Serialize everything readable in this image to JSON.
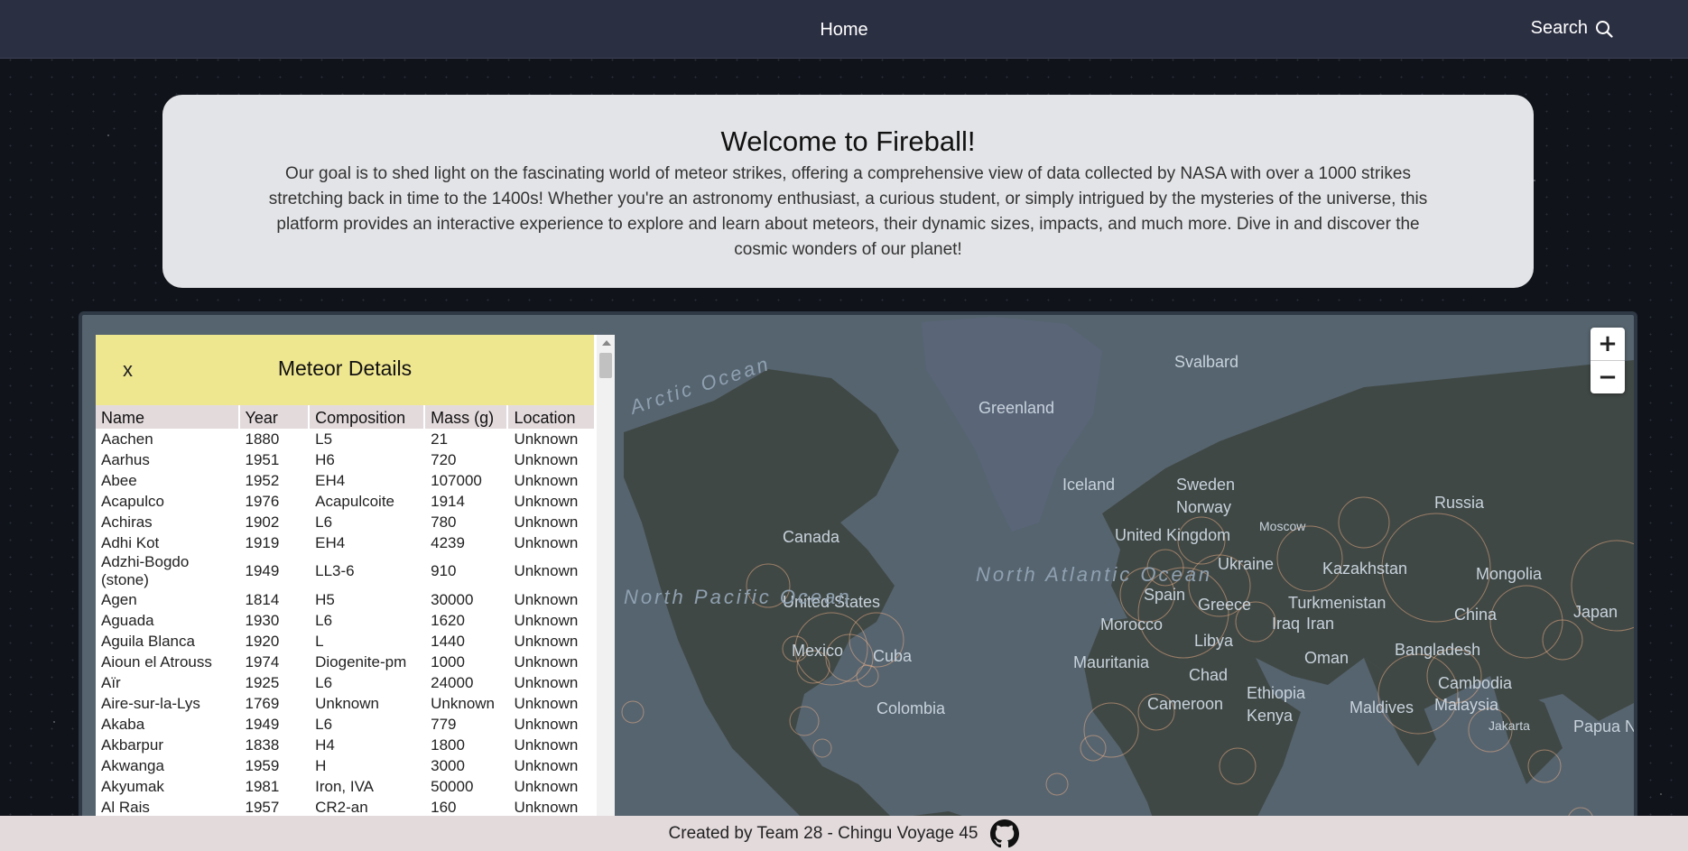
{
  "nav": {
    "home": "Home",
    "search": "Search"
  },
  "welcome": {
    "title": "Welcome to Fireball!",
    "body": "Our goal is to shed light on the fascinating world of meteor strikes, offering a comprehensive view of data collected by NASA with over a 1000 strikes stretching back in time to the 1400s! Whether you're an astronomy enthusiast, a curious student, or simply intrigued by the mysteries of the universe, this platform provides an interactive experience to explore and learn about meteors, their dynamic sizes, impacts, and much more. Dive in and discover the cosmic wonders of our planet!"
  },
  "map": {
    "zoom_in": "+",
    "zoom_out": "−",
    "labels": [
      "Svalbard",
      "Greenland",
      "Iceland",
      "Sweden",
      "Norway",
      "Russia",
      "Canada",
      "United Kingdom",
      "Moscow",
      "Ukraine",
      "Kazakhstan",
      "Mongolia",
      "Spain",
      "Greece",
      "Turkmenistan",
      "China",
      "Japan",
      "United States",
      "Iraq",
      "Iran",
      "Morocco",
      "Libya",
      "Mexico",
      "Cuba",
      "Mauritania",
      "Chad",
      "Oman",
      "Bangladesh",
      "Cambodia",
      "Malaysia",
      "Maldives",
      "Ethiopia",
      "Kenya",
      "Cameroon",
      "Colombia",
      "Jakarta",
      "Papua N"
    ],
    "oceans": [
      "Arctic Ocean",
      "North Atlantic Ocean",
      "North Pacific Ocean"
    ],
    "colors": {
      "land": "#404845",
      "water": "#56646f",
      "ice": "#5a6578",
      "dots": "#f3b48a"
    }
  },
  "panel": {
    "close": "x",
    "title": "Meteor Details",
    "columns": [
      "Name",
      "Year",
      "Composition",
      "Mass (g)",
      "Location"
    ],
    "rows": [
      [
        "Aachen",
        "1880",
        "L5",
        "21",
        "Unknown"
      ],
      [
        "Aarhus",
        "1951",
        "H6",
        "720",
        "Unknown"
      ],
      [
        "Abee",
        "1952",
        "EH4",
        "107000",
        "Unknown"
      ],
      [
        "Acapulco",
        "1976",
        "Acapulcoite",
        "1914",
        "Unknown"
      ],
      [
        "Achiras",
        "1902",
        "L6",
        "780",
        "Unknown"
      ],
      [
        "Adhi Kot",
        "1919",
        "EH4",
        "4239",
        "Unknown"
      ],
      [
        "Adzhi-Bogdo (stone)",
        "1949",
        "LL3-6",
        "910",
        "Unknown"
      ],
      [
        "Agen",
        "1814",
        "H5",
        "30000",
        "Unknown"
      ],
      [
        "Aguada",
        "1930",
        "L6",
        "1620",
        "Unknown"
      ],
      [
        "Aguila Blanca",
        "1920",
        "L",
        "1440",
        "Unknown"
      ],
      [
        "Aioun el Atrouss",
        "1974",
        "Diogenite-pm",
        "1000",
        "Unknown"
      ],
      [
        "Aïr",
        "1925",
        "L6",
        "24000",
        "Unknown"
      ],
      [
        "Aire-sur-la-Lys",
        "1769",
        "Unknown",
        "Unknown",
        "Unknown"
      ],
      [
        "Akaba",
        "1949",
        "L6",
        "779",
        "Unknown"
      ],
      [
        "Akbarpur",
        "1838",
        "H4",
        "1800",
        "Unknown"
      ],
      [
        "Akwanga",
        "1959",
        "H",
        "3000",
        "Unknown"
      ],
      [
        "Akyumak",
        "1981",
        "Iron, IVA",
        "50000",
        "Unknown"
      ],
      [
        "Al Rais",
        "1957",
        "CR2-an",
        "160",
        "Unknown"
      ]
    ]
  },
  "footer": {
    "text": "Created by Team 28 - Chingu Voyage 45",
    "icon": "github-icon"
  }
}
